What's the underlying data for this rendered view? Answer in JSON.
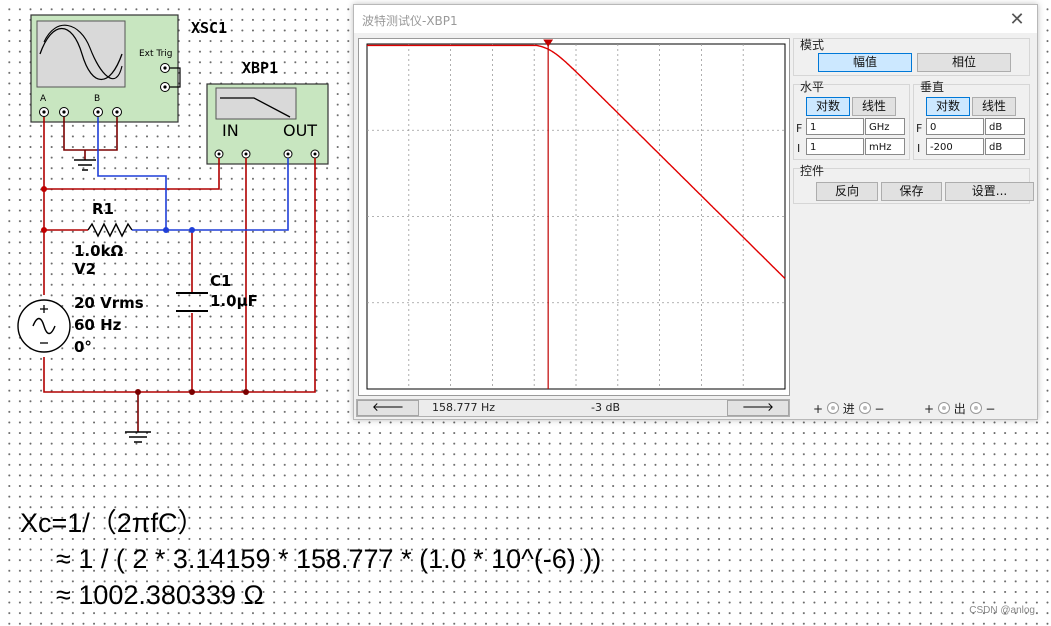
{
  "schematic": {
    "oscilloscope": {
      "name": "XSC1",
      "ext_trig": "Ext Trig",
      "ch_a": "A",
      "ch_b": "B"
    },
    "bode_instrument": {
      "name": "XBP1",
      "in_label": "IN",
      "out_label": "OUT"
    },
    "resistor": {
      "name": "R1",
      "value": "1.0kΩ"
    },
    "capacitor": {
      "name": "C1",
      "value": "1.0µF"
    },
    "source": {
      "name": "V2",
      "amplitude": "20 Vrms",
      "frequency": "60 Hz",
      "phase": "0°"
    },
    "wire_colors": {
      "red_net": "#b00000",
      "blue_net": "#1f3fd8",
      "gnd_net": "#7a0000"
    }
  },
  "bode_window": {
    "title": "波特测试仪-XBP1",
    "mode_label": "模式",
    "mode_buttons": [
      "幅值",
      "相位"
    ],
    "horizontal": {
      "label": "水平",
      "scale_buttons": [
        "对数",
        "线性"
      ],
      "final_label": "F",
      "final_value": "1",
      "final_unit": "GHz",
      "initial_label": "I",
      "initial_value": "1",
      "initial_unit": "mHz"
    },
    "vertical": {
      "label": "垂直",
      "scale_buttons": [
        "对数",
        "线性"
      ],
      "final_label": "F",
      "final_value": "0",
      "final_unit": "dB",
      "initial_label": "I",
      "initial_value": "-200",
      "initial_unit": "dB"
    },
    "controls": {
      "label": "控件",
      "buttons": [
        "反向",
        "保存",
        "设置..."
      ]
    },
    "readout": {
      "frequency": "158.777 Hz",
      "gain": "-3 dB"
    },
    "bottom": {
      "in_label": "进",
      "out_label": "出",
      "plus": "+",
      "minus": "−"
    },
    "plot": {
      "freq_min_hz": 0.001,
      "freq_max_hz": 1000000000,
      "gain_min_db": -200,
      "gain_max_db": 0,
      "cutoff_hz": 158.777,
      "trace_color": "#e00000",
      "cursor_color": "#c00000"
    }
  },
  "formula": {
    "line1": "Xc=1/（2πfC）",
    "line2": "≈ 1 / ( 2 * 3.14159 * 158.777 * (1.0 * 10^(-6) ))",
    "line3": "≈ 1002.380339 Ω"
  },
  "watermark": "CSDN @anlog"
}
